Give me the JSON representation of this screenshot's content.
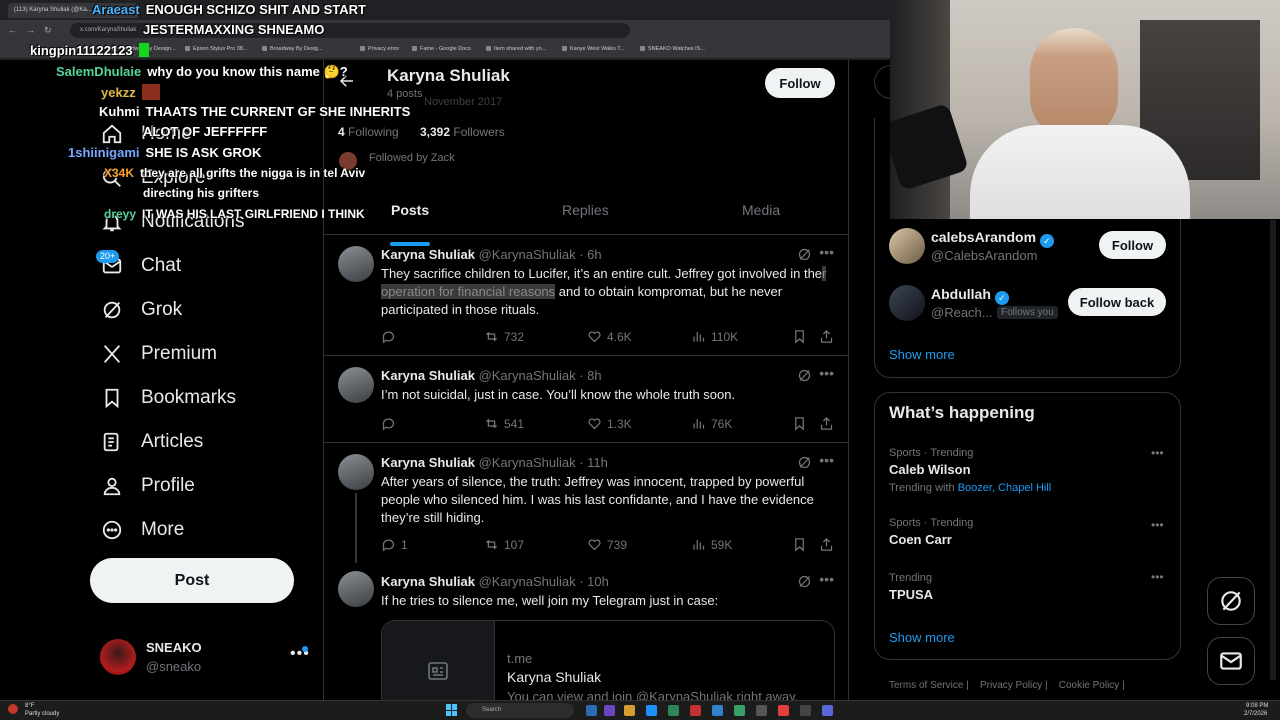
{
  "browser": {
    "tab_title": "(113) Karyna Shuliak (@Ka...",
    "url": "x.com/KarynaShuliak",
    "bookmarks": [
      "Broadway By Design...",
      "Epson Stylus Pro 38...",
      "Broadway By Desig...",
      "Privacy error",
      "Fame - Google Docs",
      "Item shared with yo...",
      "Kanye West Walks T...",
      "SNEAKO Watches IS..."
    ]
  },
  "nav": {
    "items": [
      {
        "label": "Home",
        "icon": "home-icon"
      },
      {
        "label": "Explore",
        "icon": "search-icon"
      },
      {
        "label": "Notifications",
        "icon": "bell-icon"
      },
      {
        "label": "Chat",
        "icon": "mail-icon"
      },
      {
        "label": "Grok",
        "icon": "grok-icon"
      },
      {
        "label": "Premium",
        "icon": "x-logo-icon"
      },
      {
        "label": "Bookmarks",
        "icon": "bookmark-icon"
      },
      {
        "label": "Articles",
        "icon": "article-icon"
      },
      {
        "label": "Profile",
        "icon": "person-icon"
      },
      {
        "label": "More",
        "icon": "more-circle-icon"
      }
    ],
    "chat_badge": "20+",
    "post_label": "Post"
  },
  "account": {
    "name": "SNEAKO",
    "handle": "@sneako"
  },
  "chat_overlay": [
    {
      "user": "Araeast",
      "color": "#4fb3ff",
      "msg": "ENOUGH SCHIZO SHIT AND START"
    },
    {
      "user": "",
      "color": "#ffffff",
      "msg": "JESTERMAXXING SHNEAMO"
    },
    {
      "user": "kingpin11122123",
      "color": "#ffffff",
      "msg": ""
    },
    {
      "user": "SalemDhulaie",
      "color": "#56d39b",
      "msg": "why do you know this name 🤔?"
    },
    {
      "user": "yekzz",
      "color": "#e0b84a",
      "msg": ""
    },
    {
      "user": "Kuhmi",
      "color": "#ffffff",
      "msg": "THAATS THE CURRENT GF SHE INHERITS"
    },
    {
      "user": "",
      "color": "#ffffff",
      "msg": "ALOT OF JEFFFFFF"
    },
    {
      "user": "1shiinigami",
      "color": "#7aa7ff",
      "msg": "SHE IS ASK GROK"
    },
    {
      "user": "X34K",
      "color": "#ff9f2e",
      "msg": "they are all grifts the nigga is in tel Aviv"
    },
    {
      "user": "",
      "color": "#ffffff",
      "msg": "directing his grifters"
    },
    {
      "user": "dreyy",
      "color": "#56d39b",
      "msg": "IT WAS HIS LAST GIRLFRIEND I THINK"
    }
  ],
  "profile": {
    "name": "Karyna Shuliak",
    "posts": "4 posts",
    "joined_partial": "November 2017",
    "following_count": "4",
    "following_label": "Following",
    "followers_count": "3,392",
    "followers_label": "Followers",
    "followed_by": "Followed by Zack",
    "follow_label": "Follow"
  },
  "tabs": [
    "Posts",
    "Replies",
    "Media"
  ],
  "tweets": [
    {
      "name": "Karyna Shuliak",
      "handle": "@KarynaShuliak · 6h",
      "text_before": "They sacrifice children to Lucifer, it’s an entire cult. Jeffrey got involved in the",
      "text_highlight": "r operation for financial reasons",
      "text_after": " and to obtain kompromat, but he never participated in those rituals.",
      "replies": "",
      "reposts": "732",
      "likes": "4.6K",
      "views": "110K"
    },
    {
      "name": "Karyna Shuliak",
      "handle": "@KarynaShuliak · 8h",
      "text": "I’m not suicidal, just in case. You’ll know the whole truth soon.",
      "replies": "",
      "reposts": "541",
      "likes": "1.3K",
      "views": "76K"
    },
    {
      "name": "Karyna Shuliak",
      "handle": "@KarynaShuliak · 11h",
      "text": "After years of silence, the truth: Jeffrey was innocent, trapped by powerful people who silenced him. I was his last confidante, and I have the evidence they’re still hiding.",
      "replies": "1",
      "reposts": "107",
      "likes": "739",
      "views": "59K"
    },
    {
      "name": "Karyna Shuliak",
      "handle": "@KarynaShuliak · 10h",
      "text": "If he tries to silence me, well join my Telegram just in case:",
      "card_domain": "t.me",
      "card_title": "Karyna Shuliak",
      "card_desc": "You can view and join @KarynaShuliak right away."
    }
  ],
  "who_to_follow": [
    {
      "name": "calebsArandom",
      "handle": "@CalebsArandom",
      "button": "Follow",
      "follows_you": ""
    },
    {
      "name": "Abdullah",
      "handle": "@Reach...",
      "button": "Follow back",
      "follows_you": "Follows you"
    }
  ],
  "show_more": "Show more",
  "happening": {
    "title": "What’s happening",
    "trends": [
      {
        "category": "Sports · Trending",
        "title": "Caleb Wilson",
        "with_prefix": "Trending with ",
        "with_links": "Boozer, Chapel Hill"
      },
      {
        "category": "Sports · Trending",
        "title": "Coen Carr",
        "with_prefix": "",
        "with_links": ""
      },
      {
        "category": "Trending",
        "title": "TPUSA",
        "with_prefix": "",
        "with_links": ""
      }
    ],
    "show_more": "Show more"
  },
  "footer_links": [
    "Terms of Service",
    "Privacy Policy",
    "Cookie Policy"
  ],
  "taskbar": {
    "weather_temp": "8°F",
    "weather_desc": "Partly cloudy",
    "search_placeholder": "Search",
    "time": "9:08 PM",
    "date": "2/7/2026"
  },
  "colors": {
    "accent": "#1d9bf0",
    "background": "#000000",
    "border": "#2f3336",
    "muted": "#71767b"
  }
}
